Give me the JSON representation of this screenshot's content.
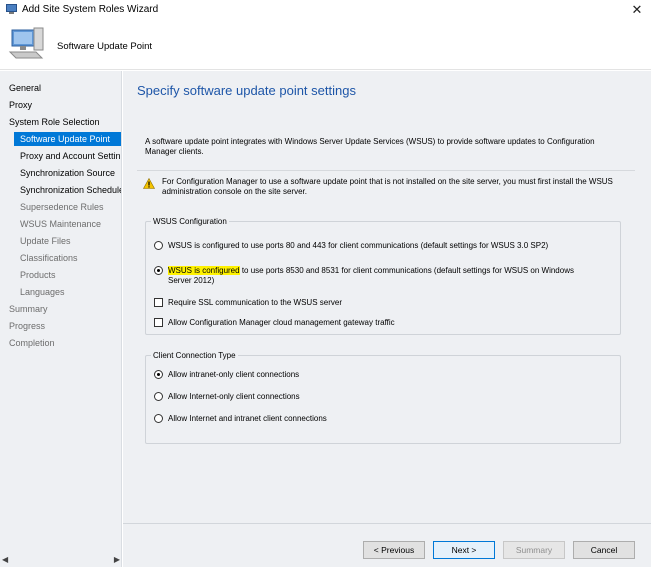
{
  "window": {
    "title": "Add Site System Roles Wizard"
  },
  "banner": {
    "title": "Software Update Point"
  },
  "nav": [
    {
      "label": "General",
      "level": 0,
      "state": "normal"
    },
    {
      "label": "Proxy",
      "level": 0,
      "state": "normal"
    },
    {
      "label": "System Role Selection",
      "level": 0,
      "state": "normal"
    },
    {
      "label": "Software Update Point",
      "level": 1,
      "state": "selected"
    },
    {
      "label": "Proxy and Account Settin",
      "level": 1,
      "state": "normal"
    },
    {
      "label": "Synchronization Source",
      "level": 1,
      "state": "normal"
    },
    {
      "label": "Synchronization Schedule",
      "level": 1,
      "state": "normal"
    },
    {
      "label": "Supersedence Rules",
      "level": 1,
      "state": "dim"
    },
    {
      "label": "WSUS Maintenance",
      "level": 1,
      "state": "dim"
    },
    {
      "label": "Update Files",
      "level": 1,
      "state": "dim"
    },
    {
      "label": "Classifications",
      "level": 1,
      "state": "dim"
    },
    {
      "label": "Products",
      "level": 1,
      "state": "dim"
    },
    {
      "label": "Languages",
      "level": 1,
      "state": "dim"
    },
    {
      "label": "Summary",
      "level": 0,
      "state": "dim"
    },
    {
      "label": "Progress",
      "level": 0,
      "state": "dim"
    },
    {
      "label": "Completion",
      "level": 0,
      "state": "dim"
    }
  ],
  "main": {
    "heading": "Specify software update point settings",
    "intro": "A software update point integrates with Windows Server Update Services (WSUS) to provide software updates to Configuration Manager clients.",
    "warning": "For Configuration Manager to use a software update point that is not installed on the site server, you must first install the WSUS administration console on the site server.",
    "wsus": {
      "legend": "WSUS Configuration",
      "option1": "WSUS is configured to use ports 80 and 443 for client communications (default settings for WSUS 3.0 SP2)",
      "option2_highlight": "WSUS is configured",
      "option2_rest": " to use ports 8530 and 8531 for client communications (default settings for WSUS on Windows Server 2012)",
      "selected_option": 2,
      "ssl_label": "Require SSL communication to the WSUS server",
      "ssl_checked": false,
      "cmg_label": "Allow Configuration Manager cloud management gateway traffic",
      "cmg_checked": false
    },
    "client": {
      "legend": "Client Connection Type",
      "options": [
        "Allow intranet-only client connections",
        "Allow Internet-only client connections",
        "Allow Internet and intranet client connections"
      ],
      "selected": 0
    }
  },
  "buttons": {
    "previous": "< Previous",
    "next": "Next >",
    "summary": "Summary",
    "cancel": "Cancel"
  }
}
